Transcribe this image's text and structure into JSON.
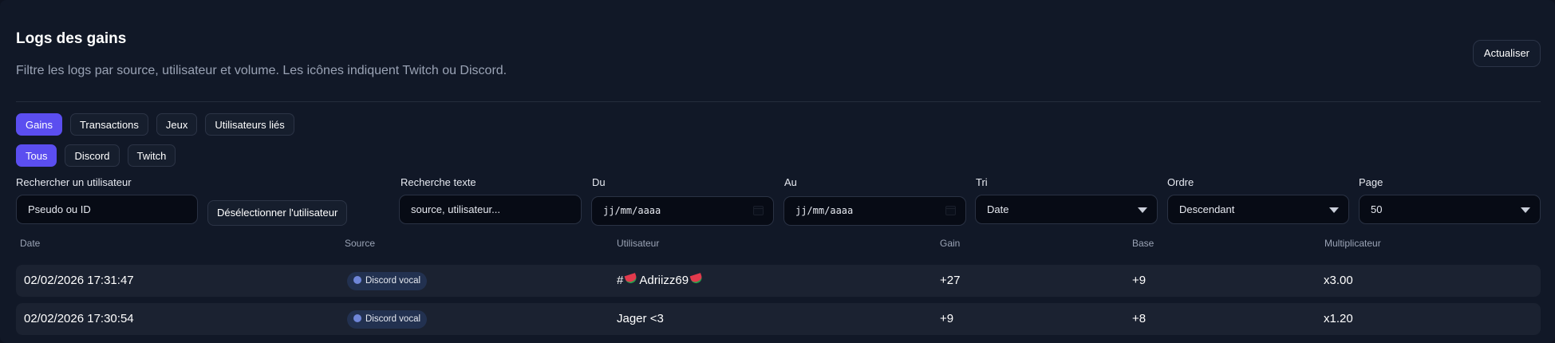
{
  "header": {
    "title": "Logs des gains",
    "subtitle": "Filtre les logs par source, utilisateur et volume. Les icônes indiquent Twitch ou Discord.",
    "refresh_label": "Actualiser"
  },
  "tabs": [
    {
      "label": "Gains",
      "active": true
    },
    {
      "label": "Transactions",
      "active": false
    },
    {
      "label": "Jeux",
      "active": false
    },
    {
      "label": "Utilisateurs liés",
      "active": false
    }
  ],
  "source_filters": [
    {
      "label": "Tous",
      "active": true
    },
    {
      "label": "Discord",
      "active": false
    },
    {
      "label": "Twitch",
      "active": false
    }
  ],
  "filters": {
    "user_search": {
      "label": "Rechercher un utilisateur",
      "placeholder": "Pseudo ou ID"
    },
    "deselect_label": "Désélectionner l'utilisateur",
    "text_search": {
      "label": "Recherche texte",
      "placeholder": "source, utilisateur..."
    },
    "from": {
      "label": "Du",
      "placeholder": "jj/mm/aaaa"
    },
    "to": {
      "label": "Au",
      "placeholder": "jj/mm/aaaa"
    },
    "sort": {
      "label": "Tri",
      "value": "Date"
    },
    "order": {
      "label": "Ordre",
      "value": "Descendant"
    },
    "page": {
      "label": "Page",
      "value": "50"
    }
  },
  "table": {
    "columns": [
      "Date",
      "Source",
      "Utilisateur",
      "Gain",
      "Base",
      "Multiplicateur"
    ],
    "rows": [
      {
        "date": "02/02/2026 17:31:47",
        "source": "Discord vocal",
        "user_prefix": "#",
        "user": "Adriizz69",
        "user_emoji": true,
        "gain": "+27",
        "base": "+9",
        "mult": "x3.00"
      },
      {
        "date": "02/02/2026 17:30:54",
        "source": "Discord vocal",
        "user_prefix": "",
        "user": "Jager <3",
        "user_emoji": false,
        "gain": "+9",
        "base": "+8",
        "mult": "x1.20"
      }
    ]
  },
  "colors": {
    "accent": "#5b4ef0",
    "background": "#111827",
    "row": "#1b2231",
    "badge": "#223150"
  }
}
